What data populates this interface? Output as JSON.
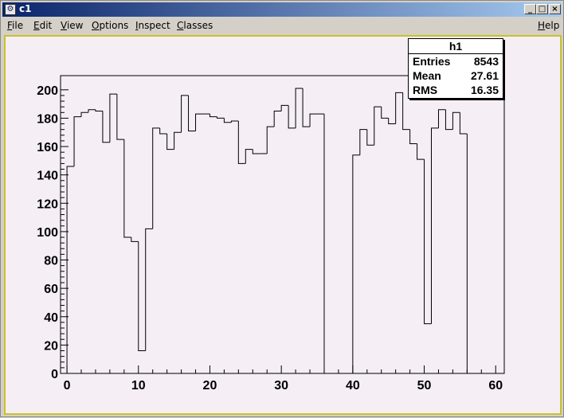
{
  "window": {
    "title": "c1",
    "buttons": {
      "minimize": "_",
      "maximize": "□",
      "close": "×"
    }
  },
  "menu": {
    "items": [
      "File",
      "Edit",
      "View",
      "Options",
      "Inspect",
      "Classes"
    ],
    "help": "Help"
  },
  "stats": {
    "title": "h1",
    "rows": [
      {
        "label": "Entries",
        "value": "8543"
      },
      {
        "label": "Mean",
        "value": "27.61"
      },
      {
        "label": "RMS",
        "value": "16.35"
      }
    ]
  },
  "chart_data": {
    "type": "bar",
    "style": "step-histogram",
    "bin_width": 1,
    "x_start": 0,
    "bins": [
      146,
      181,
      184,
      186,
      185,
      163,
      197,
      165,
      96,
      93,
      16,
      102,
      173,
      169,
      158,
      170,
      196,
      171,
      183,
      183,
      181,
      180,
      177,
      178,
      148,
      158,
      155,
      155,
      174,
      185,
      189,
      173,
      201,
      174,
      183,
      183,
      0,
      0,
      0,
      0,
      154,
      172,
      161,
      188,
      180,
      176,
      198,
      172,
      162,
      151,
      35,
      173,
      186,
      172,
      184,
      169
    ],
    "xlim": [
      -0.9,
      61.2
    ],
    "ylim": [
      0,
      210
    ],
    "xticks": [
      "0",
      "10",
      "20",
      "30",
      "40",
      "50",
      "60"
    ],
    "yticks": [
      "0",
      "20",
      "40",
      "60",
      "80",
      "100",
      "120",
      "140",
      "160",
      "180",
      "200"
    ],
    "colors": {
      "line": "#000000",
      "background": "#f5eef5",
      "frame": "#c8c228"
    }
  }
}
